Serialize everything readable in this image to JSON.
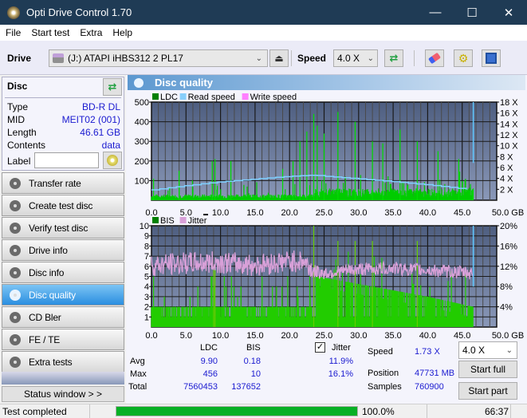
{
  "window": {
    "title": "Opti Drive Control 1.70"
  },
  "menu": [
    "File",
    "Start test",
    "Extra",
    "Help"
  ],
  "toolbar": {
    "drive_label": "Drive",
    "drive_value": "(J:)  ATAPI iHBS312  2 PL17",
    "speed_label": "Speed",
    "speed_value": "4.0 X"
  },
  "disc": {
    "header": "Disc",
    "type_label": "Type",
    "type_value": "BD-R DL",
    "mid_label": "MID",
    "mid_value": "MEIT02 (001)",
    "length_label": "Length",
    "length_value": "46.61 GB",
    "contents_label": "Contents",
    "contents_value": "data",
    "label_label": "Label",
    "label_value": ""
  },
  "nav": [
    {
      "label": "Transfer rate"
    },
    {
      "label": "Create test disc"
    },
    {
      "label": "Verify test disc"
    },
    {
      "label": "Drive info"
    },
    {
      "label": "Disc info"
    },
    {
      "label": "Disc quality",
      "active": true
    },
    {
      "label": "CD Bler"
    },
    {
      "label": "FE / TE"
    },
    {
      "label": "Extra tests"
    }
  ],
  "status_window_label": "Status window > >",
  "panel_title": "Disc quality",
  "chart_data": [
    {
      "type": "bar",
      "title": "LDC / Read speed",
      "legend": [
        "LDC",
        "Read speed",
        "Write speed"
      ],
      "legend_colors": [
        "#008000",
        "#87cefa",
        "#ff80ff"
      ],
      "x_ticks": [
        "0.0",
        "5.0",
        "10.0",
        "15.0",
        "20.0",
        "25.0",
        "30.0",
        "35.0",
        "40.0",
        "45.0",
        "50.0 GB"
      ],
      "y_left_ticks": [
        "500",
        "400",
        "300",
        "200",
        "100"
      ],
      "y_right_ticks": [
        "18 X",
        "16 X",
        "14 X",
        "12 X",
        "10 X",
        "8 X",
        "6 X",
        "4 X",
        "2 X"
      ],
      "xlim": [
        0,
        50
      ],
      "ylim": [
        0,
        500
      ],
      "y2lim": [
        0,
        18
      ],
      "read_speed": {
        "x": [
          0,
          5,
          10,
          15,
          20,
          23.5,
          25,
          30,
          35,
          40,
          45,
          46.6
        ],
        "y": [
          1.9,
          2.7,
          3.4,
          3.9,
          4.4,
          4.6,
          4.4,
          3.9,
          3.4,
          2.8,
          2.1,
          1.7
        ]
      },
      "ldc_peaks": {
        "x": [
          0.3,
          4,
          8.8,
          9.2,
          11.5,
          19,
          20.5,
          21.5,
          22.5,
          23.5,
          24,
          25,
          27,
          29.5,
          32,
          33.5,
          36,
          38.5,
          41.5,
          44.5,
          46.6
        ],
        "y": [
          110,
          150,
          200,
          210,
          200,
          160,
          200,
          300,
          350,
          440,
          380,
          340,
          450,
          400,
          300,
          290,
          360,
          300,
          250,
          210,
          60
        ]
      },
      "end_marker_x": 46.61
    },
    {
      "type": "bar",
      "title": "BIS / Jitter",
      "legend": [
        "BIS",
        "Jitter"
      ],
      "legend_colors": [
        "#008000",
        "#d8a0d8"
      ],
      "x_ticks": [
        "0.0",
        "5.0",
        "10.0",
        "15.0",
        "20.0",
        "25.0",
        "30.0",
        "35.0",
        "40.0",
        "45.0",
        "50.0 GB"
      ],
      "y_left_ticks": [
        "10",
        "9",
        "8",
        "7",
        "6",
        "5",
        "4",
        "3",
        "2",
        "1"
      ],
      "y_right_ticks": [
        "20%",
        "16%",
        "12%",
        "8%",
        "4%"
      ],
      "xlim": [
        0,
        50
      ],
      "ylim": [
        0,
        10
      ],
      "y2lim": [
        0,
        20
      ],
      "jitter": {
        "x": [
          0,
          5,
          10,
          15,
          20,
          22,
          23.5,
          25,
          30,
          35,
          40,
          45,
          46.6
        ],
        "y": [
          12.2,
          12.6,
          12.8,
          12.2,
          13.0,
          13.0,
          11.0,
          10.6,
          11.4,
          11.6,
          11.2,
          10.8,
          10.6
        ]
      },
      "bis_baseline": {
        "x": [
          0,
          23.5,
          24,
          40,
          46.6
        ],
        "y": [
          2,
          2,
          5,
          3,
          2
        ]
      },
      "end_marker_x": 46.61
    }
  ],
  "stats": {
    "col_ldc": "LDC",
    "col_bis": "BIS",
    "jitter_label": "Jitter",
    "jitter_checked": true,
    "avg_label": "Avg",
    "max_label": "Max",
    "total_label": "Total",
    "avg_ldc": "9.90",
    "avg_bis": "0.18",
    "avg_jitter": "11.9%",
    "max_ldc": "456",
    "max_bis": "10",
    "max_jitter": "16.1%",
    "total_ldc": "7560453",
    "total_bis": "137652",
    "speed_label": "Speed",
    "speed_value": "1.73 X",
    "position_label": "Position",
    "position_value": "47731 MB",
    "samples_label": "Samples",
    "samples_value": "760900",
    "speed_select": "4.0 X",
    "start_full": "Start full",
    "start_part": "Start part"
  },
  "status": {
    "text": "Test completed",
    "progress_pct": 100.0,
    "progress_label": "100.0%",
    "time": "66:37"
  }
}
